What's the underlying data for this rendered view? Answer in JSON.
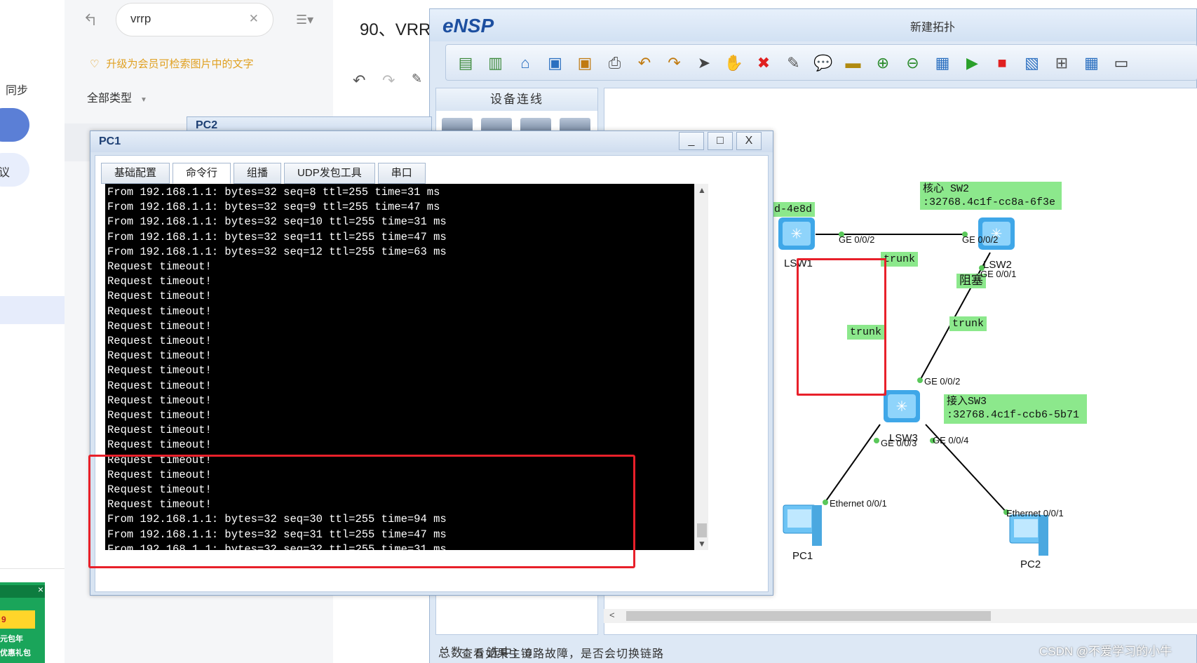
{
  "background": {
    "sidebar": {
      "sync_label": "同步",
      "pill_label": "议"
    },
    "search": {
      "value": "vrrp",
      "clear_icon": "close-icon"
    },
    "upgrade_text": "升级为会员可检索图片中的文字",
    "filter_label": "全部类型",
    "doc_title": "90、VRR",
    "doc_bottom_text": "查看如果主链路故障，是否会切换链路",
    "ad": {
      "line1": "元包年",
      "line2": "优惠礼包",
      "badge": "9"
    }
  },
  "ensp": {
    "logo": "eNSP",
    "window_title": "新建拓扑",
    "side_panel_title": "设备连线",
    "status": "总数：5 选中：0",
    "toolbar_icons": [
      "new-topology-icon",
      "new-example-icon",
      "open-icon",
      "save-icon",
      "save-as-icon",
      "print-icon",
      "undo-icon",
      "redo-icon",
      "select-icon",
      "hand-icon",
      "delete-icon",
      "delete-link-icon",
      "text-icon",
      "rectangle-icon",
      "zoom-in-icon",
      "zoom-out-icon",
      "fit-icon",
      "start-icon",
      "stop-icon",
      "capture-icon",
      "topology-icon",
      "grid-icon",
      "console-icon"
    ]
  },
  "pc2_window": {
    "title": "PC2"
  },
  "pc1_window": {
    "title": "PC1",
    "tabs": [
      "基础配置",
      "命令行",
      "组播",
      "UDP发包工具",
      "串口"
    ],
    "active_tab": 1,
    "console_lines": [
      "From 192.168.1.1: bytes=32 seq=8 ttl=255 time=31 ms",
      "From 192.168.1.1: bytes=32 seq=9 ttl=255 time=47 ms",
      "From 192.168.1.1: bytes=32 seq=10 ttl=255 time=31 ms",
      "From 192.168.1.1: bytes=32 seq=11 ttl=255 time=47 ms",
      "From 192.168.1.1: bytes=32 seq=12 ttl=255 time=63 ms",
      "Request timeout!",
      "Request timeout!",
      "Request timeout!",
      "Request timeout!",
      "Request timeout!",
      "Request timeout!",
      "Request timeout!",
      "Request timeout!",
      "Request timeout!",
      "Request timeout!",
      "Request timeout!",
      "Request timeout!",
      "Request timeout!",
      "Request timeout!",
      "Request timeout!",
      "Request timeout!",
      "Request timeout!",
      "From 192.168.1.1: bytes=32 seq=30 ttl=255 time=94 ms",
      "From 192.168.1.1: bytes=32 seq=31 ttl=255 time=47 ms",
      "From 192.168.1.1: bytes=32 seq=32 ttl=255 time=31 ms"
    ]
  },
  "topology": {
    "labels": {
      "sw1_mac": "d-4e8d",
      "sw2_title": "核心 SW2",
      "sw2_mac": ":32768.4c1f-cc8a-6f3e",
      "sw3_title": "接入SW3",
      "sw3_mac": ":32768.4c1f-ccb6-5b71",
      "trunk_top": "trunk",
      "trunk_mid": "trunk",
      "trunk_right": "trunk",
      "blocked": "阻塞"
    },
    "ports": {
      "lsw1_ge002": "GE 0/0/2",
      "lsw2_ge002": "GE 0/0/2",
      "lsw2_ge001": "GE 0/0/1",
      "lsw3_ge002": "GE 0/0/2",
      "lsw3_ge003": "GE 0/0/3",
      "lsw3_ge004": "GE 0/0/4",
      "pc1_eth": "Ethernet 0/0/1",
      "pc2_eth": "Ethernet 0/0/1"
    },
    "devices": {
      "lsw1": "LSW1",
      "lsw2": "LSW2",
      "lsw3": "LSW3",
      "pc1": "PC1",
      "pc2": "PC2"
    },
    "colors": {
      "label_bg": "#8ce88c",
      "highlight": "#e8202a",
      "link": "#000000",
      "port_dot": "#5ac85a"
    }
  },
  "watermark": "CSDN @不爱学习的小牛"
}
